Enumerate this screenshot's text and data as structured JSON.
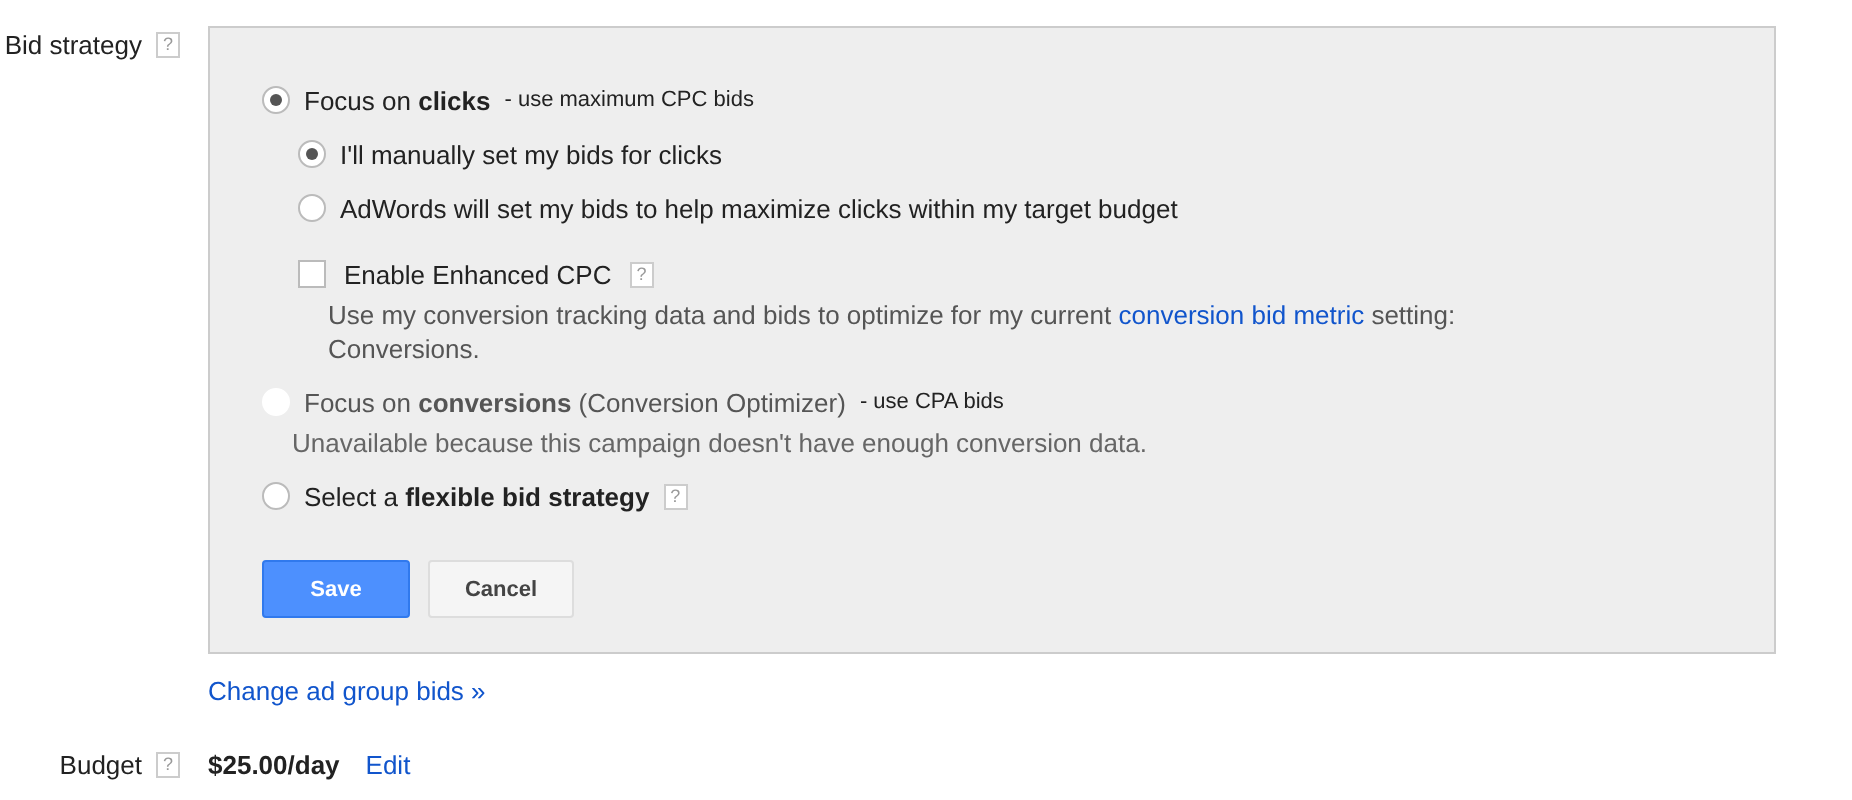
{
  "bid_strategy": {
    "label": "Bid strategy",
    "help": "?",
    "options": [
      {
        "label": "Focus on **clicks**",
        "note": "- use maximum CPC bids",
        "selected": true,
        "disabled": false,
        "children": [
          {
            "label": "I'll manually set my bids for clicks",
            "selected": true
          },
          {
            "label": "AdWords will set my bids to help maximize clicks within my target budget",
            "selected": false
          }
        ],
        "enhanced": {
          "label": "Enable Enhanced CPC",
          "help": "?",
          "checked": false,
          "description_before": "Use my conversion tracking data and bids to optimize for my current",
          "link": "conversion bid metric",
          "description_after": "setting: Conversions."
        }
      },
      {
        "label": "Focus on **conversions** (Conversion Optimizer)",
        "note": "- use CPA bids",
        "selected": false,
        "disabled": true,
        "description": "Unavailable because this campaign doesn't have enough conversion data."
      },
      {
        "label": "Select a **flexible bid strategy**",
        "help": "?",
        "selected": false,
        "disabled": false
      }
    ],
    "buttons": [
      {
        "label": "Save",
        "kind": "primary"
      },
      {
        "label": "Cancel",
        "kind": "secondary"
      }
    ],
    "link": "Change ad group bids »"
  },
  "budget": {
    "label": "Budget",
    "help": "?",
    "value": "$25.00/day",
    "link": "Edit"
  }
}
